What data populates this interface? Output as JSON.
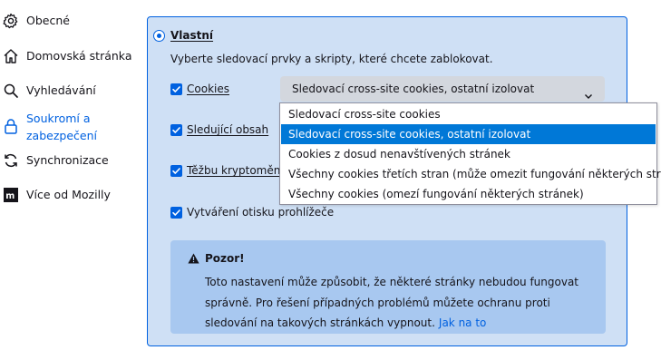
{
  "sidebar": {
    "items": [
      {
        "label": "Obecné",
        "icon": "gear-icon"
      },
      {
        "label": "Domovská stránka",
        "icon": "home-icon"
      },
      {
        "label": "Vyhledávání",
        "icon": "search-icon"
      },
      {
        "label_line1": "Soukromí a",
        "label_line2": "zabezpečení",
        "icon": "lock-icon",
        "active": true
      },
      {
        "label": "Synchronizace",
        "icon": "sync-icon"
      },
      {
        "label": "Více od Mozilly",
        "icon": "mozilla-icon"
      }
    ]
  },
  "custom": {
    "radio_label": "Vlastní",
    "description": "Vyberte sledovací prvky a skripty, které chcete zablokovat.",
    "cookies_label": "Cookies",
    "tracking_label": "Sledující obsah",
    "crypto_label": "Těžbu kryptoměn",
    "fingerprint_label": "Vytváření otisku prohlížeče",
    "cookies_select_value": "Sledovací cross-site cookies, ostatní izolovat"
  },
  "dropdown": {
    "options": [
      "Sledovací cross-site cookies",
      "Sledovací cross-site cookies, ostatní izolovat",
      "Cookies z dosud nenavštívených stránek",
      "Všechny cookies třetích stran (může omezit fungování některých stránek)",
      "Všechny cookies (omezí fungování některých stránek)"
    ],
    "selected_index": 1
  },
  "warning": {
    "title": "Pozor!",
    "body": "Toto nastavení může způsobit, že některé stránky nebudou fungovat správně. Pro řešení případných problémů můžete ochranu proti sledování na takových stránkách vypnout.",
    "link": "Jak na to"
  },
  "colors": {
    "accent": "#0061e0",
    "panel_bg": "#cfe0f5",
    "warning_bg": "#a8c8f0",
    "selected_option": "#0078d7"
  }
}
